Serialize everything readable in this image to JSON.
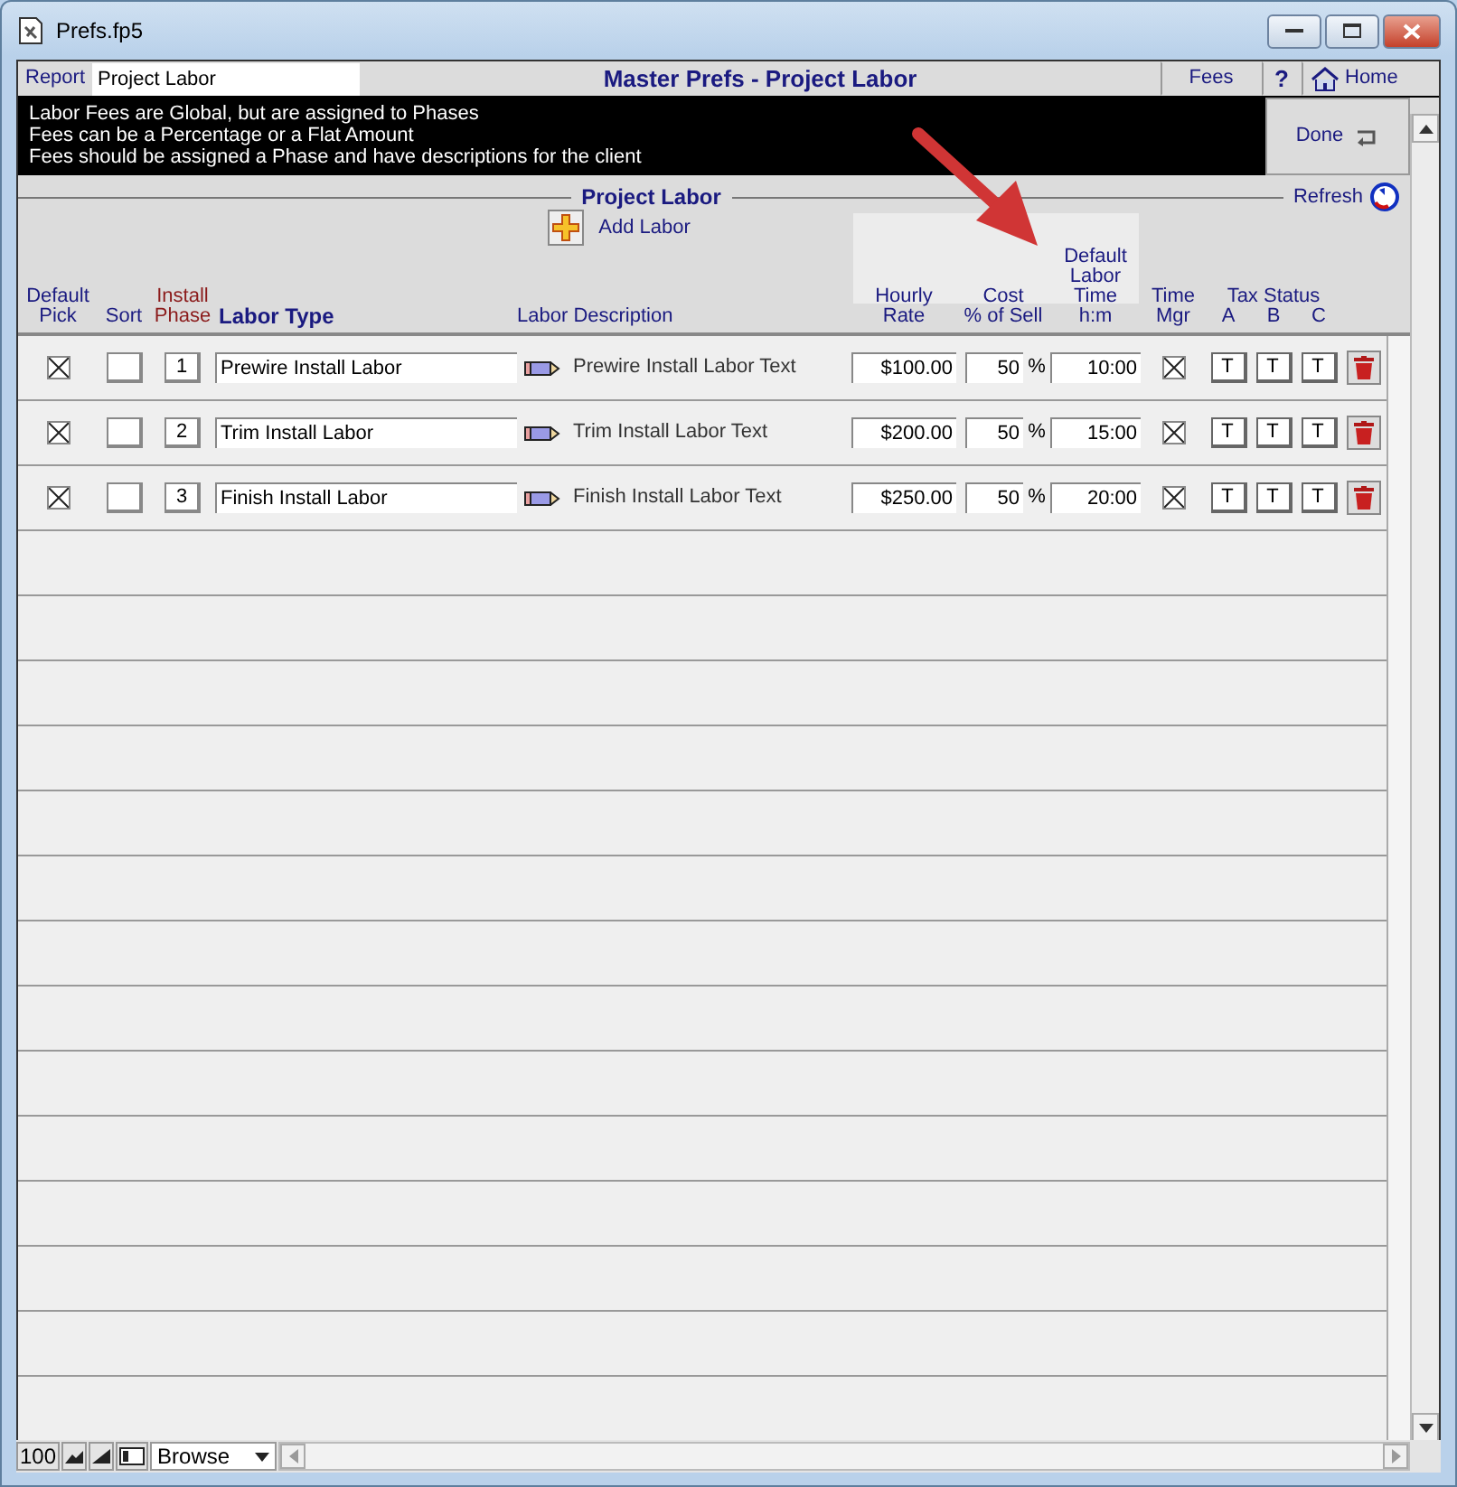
{
  "window": {
    "title": "Prefs.fp5"
  },
  "header": {
    "report_label": "Report",
    "report_value": "Project Labor",
    "title": "Master Prefs - Project Labor",
    "fees": "Fees",
    "help": "?",
    "home": "Home"
  },
  "info_lines": [
    "Labor Fees are Global, but are assigned to Phases",
    "Fees can be a Percentage or a Flat Amount",
    "Fees should be assigned a Phase and have descriptions for the client"
  ],
  "done_button": "Done",
  "section": {
    "title": "Project Labor",
    "refresh": "Refresh",
    "add_button": "Add Labor"
  },
  "columns": [
    {
      "text": "Default\nPick",
      "kind": "plain"
    },
    {
      "text": "Sort",
      "kind": "plain"
    },
    {
      "text": "Install\nPhase",
      "kind": "accent"
    },
    {
      "text": "Labor Type",
      "kind": "bold"
    },
    {
      "text": "Labor Description",
      "kind": "plain"
    },
    {
      "text": "Hourly\nRate",
      "kind": "plain"
    },
    {
      "text": "Cost\n% of Sell",
      "kind": "plain"
    },
    {
      "text": "Default\nLabor\nTime\nh:m",
      "kind": "plain"
    },
    {
      "text": "Time\nMgr",
      "kind": "plain"
    },
    {
      "text": "Tax Status",
      "kind": "plain"
    },
    {
      "text": "A",
      "kind": "plain"
    },
    {
      "text": "B",
      "kind": "plain"
    },
    {
      "text": "C",
      "kind": "plain"
    }
  ],
  "rows": [
    {
      "default_pick": true,
      "phase": "1",
      "labor_type": "Prewire Install Labor",
      "description": "Prewire Install Labor Text",
      "rate": "$100.00",
      "cost": "50",
      "percent": "%",
      "time": "10:00",
      "time_mgr": true,
      "tax": [
        "T",
        "T",
        "T"
      ]
    },
    {
      "default_pick": true,
      "phase": "2",
      "labor_type": "Trim Install Labor",
      "description": "Trim Install Labor Text",
      "rate": "$200.00",
      "cost": "50",
      "percent": "%",
      "time": "15:00",
      "time_mgr": true,
      "tax": [
        "T",
        "T",
        "T"
      ]
    },
    {
      "default_pick": true,
      "phase": "3",
      "labor_type": "Finish Install Labor",
      "description": "Finish Install Labor Text",
      "rate": "$250.00",
      "cost": "50",
      "percent": "%",
      "time": "20:00",
      "time_mgr": true,
      "tax": [
        "T",
        "T",
        "T"
      ]
    }
  ],
  "status_bar": {
    "zoom": "100",
    "mode": "Browse"
  }
}
